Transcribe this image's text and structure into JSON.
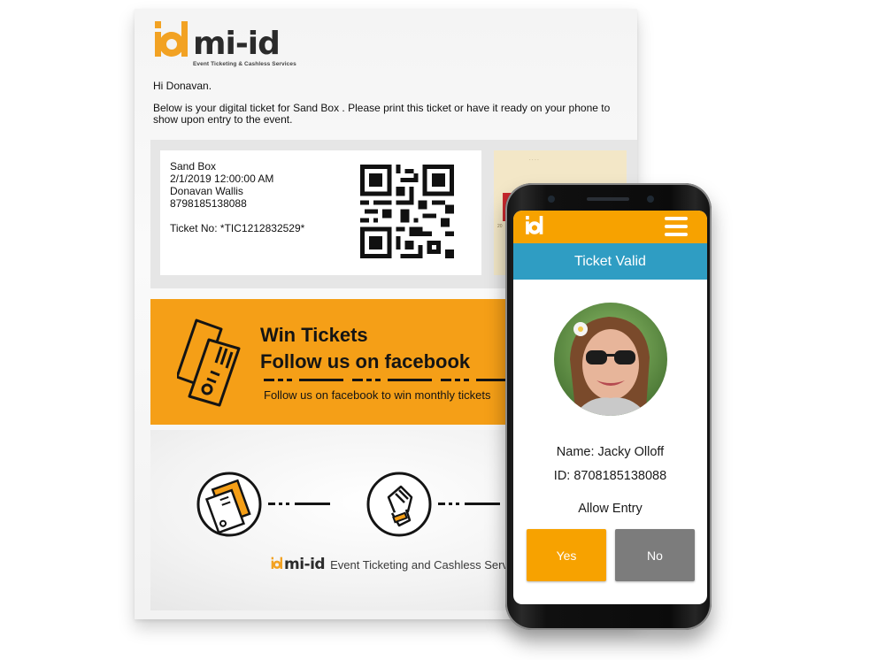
{
  "email": {
    "brand": {
      "logo_text": "mi-id",
      "tagline": "Event Ticketing & Cashless Services"
    },
    "greeting": "Hi Donavan.",
    "intro": "Below is your digital ticket for Sand Box .  Please print this ticket or have it ready on your phone to show upon entry to the event.",
    "ticket": {
      "event_name": "Sand Box",
      "date_time": "2/1/2019 12:00:00 AM",
      "holder_name": "Donavan Wallis",
      "phone": "8798185138088",
      "ticket_no": "Ticket No: *TIC1212832529*",
      "qr_icon": "qr-code"
    },
    "banner": {
      "line1": "Win Tickets",
      "line2": "Follow us on facebook",
      "subline": "Follow us on facebook to win monthly tickets",
      "icon": "ticket-stubs-icon"
    },
    "steps": {
      "icons": [
        "card-icon",
        "wristband-icon"
      ],
      "footer_logo": "mi-id",
      "footer_text": "Event Ticketing and Cashless Services"
    }
  },
  "phone_app": {
    "logo_icon": "mi-id-logo",
    "menu_icon": "hamburger-menu-icon",
    "status_title": "Ticket Valid",
    "name_line": "Name: Jacky Olloff",
    "id_line": "ID: 8708185138088",
    "prompt": "Allow Entry",
    "yes_label": "Yes",
    "no_label": "No",
    "colors": {
      "accent": "#f7a200",
      "status_bar": "#2f9dc3",
      "no_button": "#7c7c7c"
    }
  }
}
